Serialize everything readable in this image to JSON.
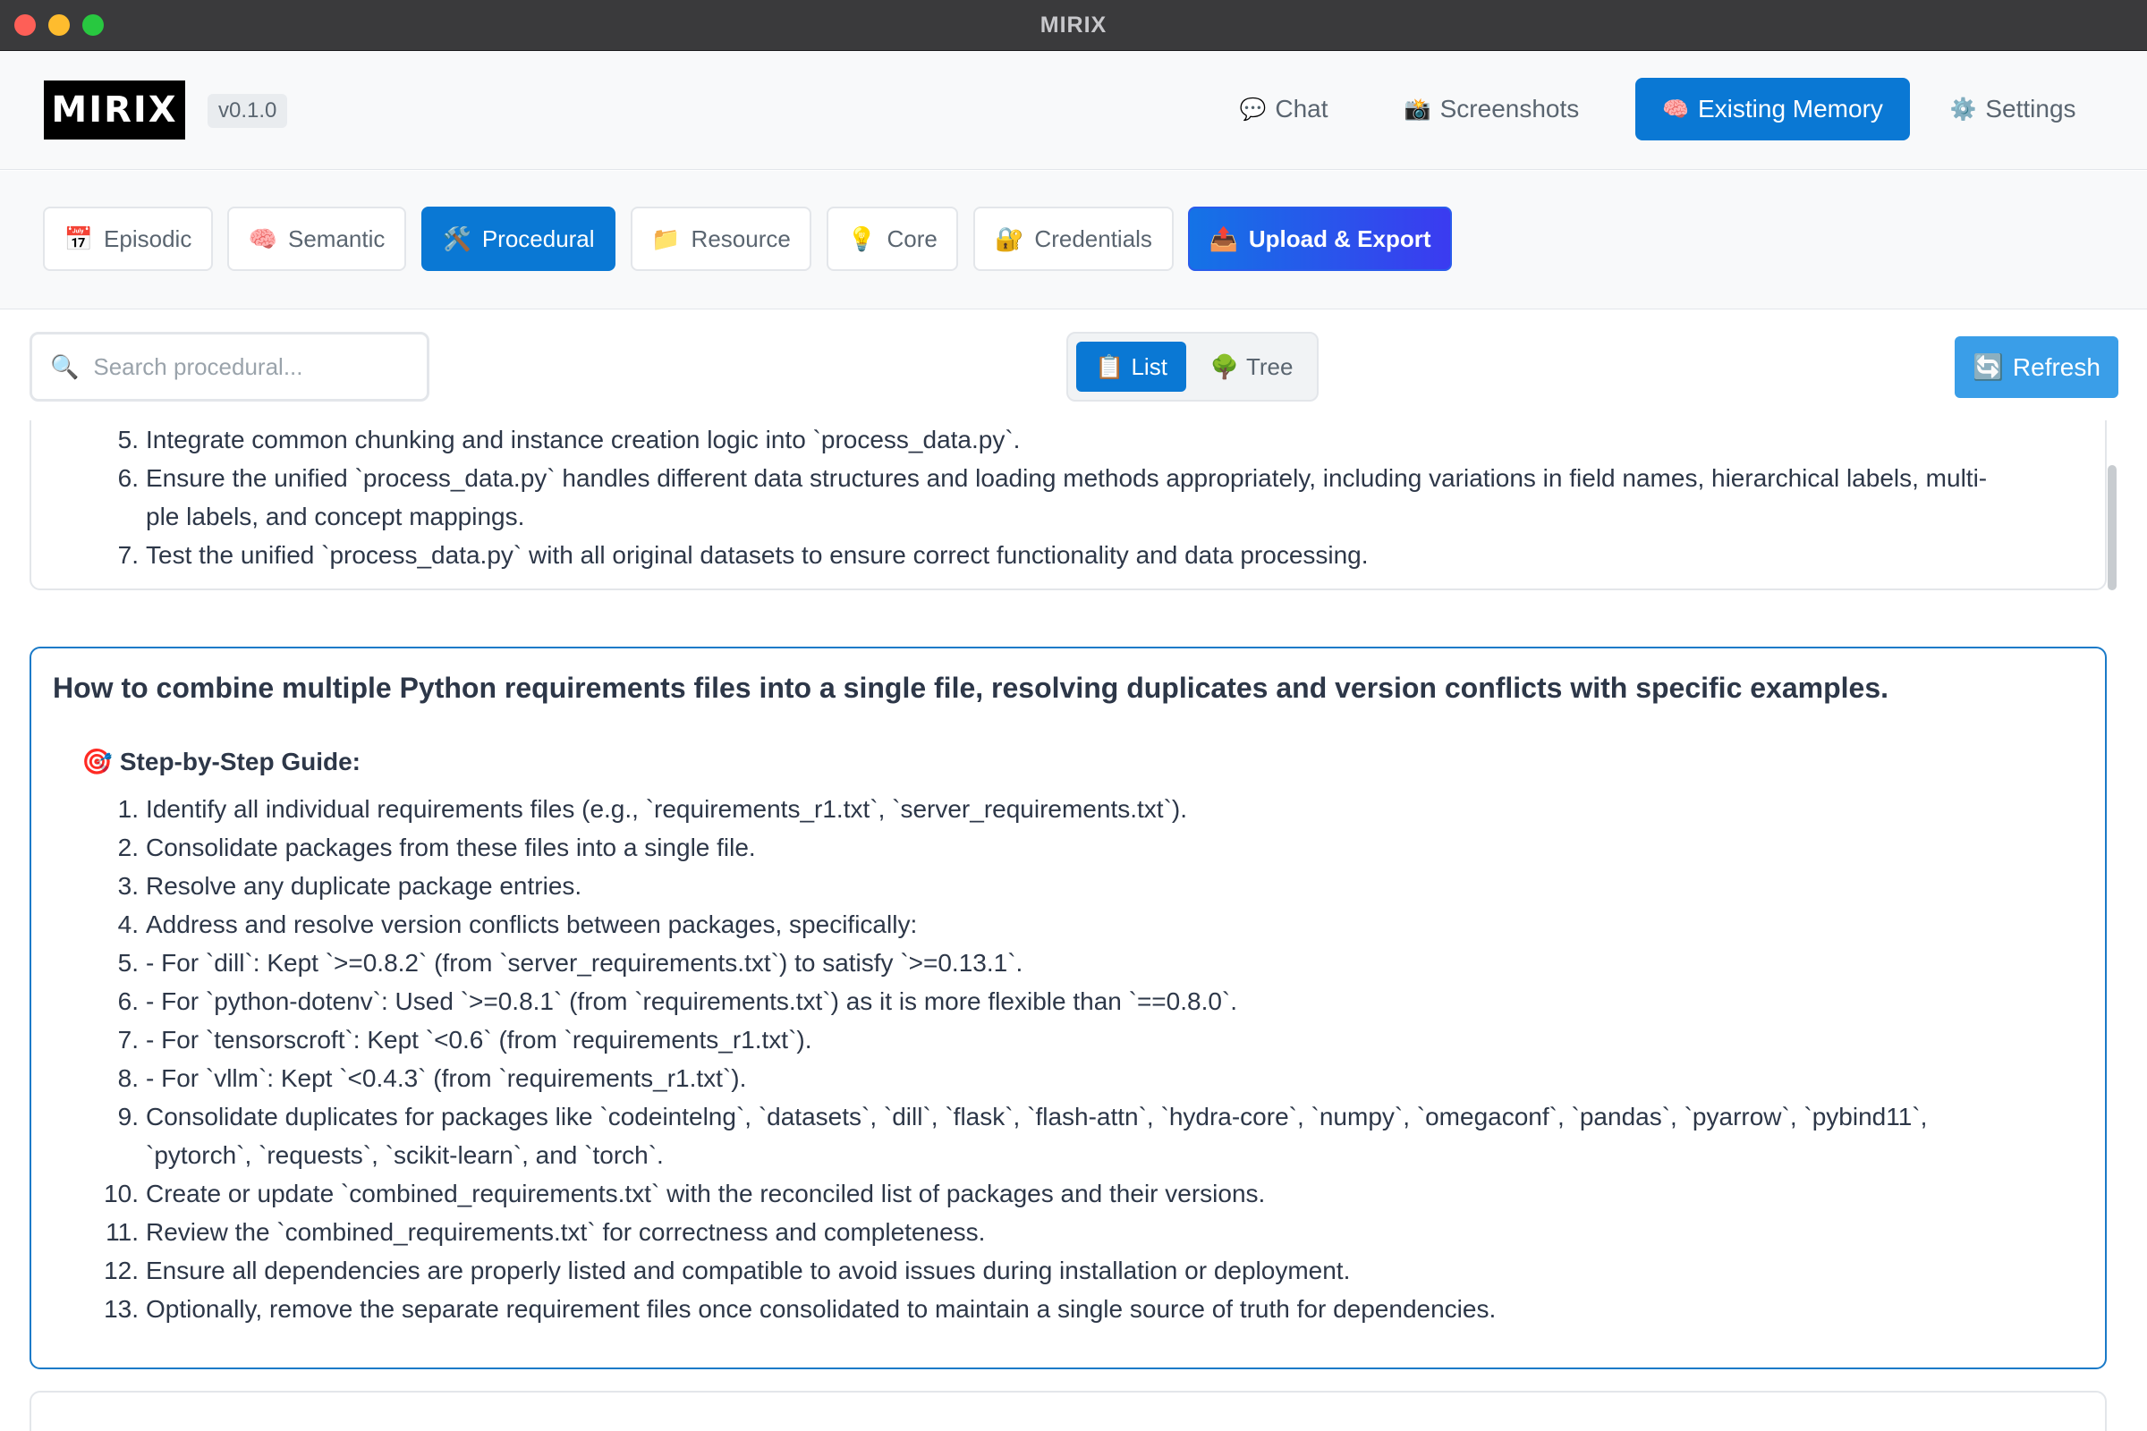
{
  "window": {
    "title": "MIRIX"
  },
  "header": {
    "logo_text": "MIRIX",
    "version": "v0.1.0",
    "nav": [
      {
        "icon": "💬",
        "label": "Chat"
      },
      {
        "icon": "📸",
        "label": "Screenshots"
      },
      {
        "icon": "🧠",
        "label": "Existing Memory"
      },
      {
        "icon": "⚙️",
        "label": "Settings"
      }
    ]
  },
  "memory_tabs": [
    {
      "icon": "📅",
      "label": "Episodic"
    },
    {
      "icon": "🧠",
      "label": "Semantic"
    },
    {
      "icon": "🛠️",
      "label": "Procedural"
    },
    {
      "icon": "📁",
      "label": "Resource"
    },
    {
      "icon": "💡",
      "label": "Core"
    },
    {
      "icon": "🔐",
      "label": "Credentials"
    },
    {
      "icon": "📤",
      "label": "Upload & Export"
    }
  ],
  "active_memory_tab": "Procedural",
  "toolbar": {
    "search_icon": "🔍",
    "search_placeholder": "Search procedural...",
    "view_list": {
      "icon": "📋",
      "label": "List"
    },
    "view_tree": {
      "icon": "🌳",
      "label": "Tree"
    },
    "refresh": {
      "icon": "🔄",
      "label": "Refresh"
    }
  },
  "previous_entry": {
    "steps": [
      {
        "num": "5.",
        "text": "Integrate common chunking and instance creation logic into `process_data.py`."
      },
      {
        "num": "6.",
        "text": "Ensure the unified `process_data.py` handles different data structures and loading methods appropriately, including variations in field names, hierarchical labels, multi-"
      },
      {
        "num": "",
        "text": "ple labels, and concept mappings."
      },
      {
        "num": "7.",
        "text": "Test the unified `process_data.py` with all original datasets to ensure correct functionality and data processing."
      }
    ]
  },
  "current_entry": {
    "title": "How to combine multiple Python requirements files into a single file, resolving duplicates and version conflicts with specific examples.",
    "guide_icon": "🎯",
    "guide_label": "Step-by-Step Guide:",
    "steps": [
      {
        "num": "1.",
        "text": "Identify all individual requirements files (e.g., `requirements_r1.txt`, `server_requirements.txt`)."
      },
      {
        "num": "2.",
        "text": "Consolidate packages from these files into a single file."
      },
      {
        "num": "3.",
        "text": "Resolve any duplicate package entries."
      },
      {
        "num": "4.",
        "text": "Address and resolve version conflicts between packages, specifically:"
      },
      {
        "num": "5.",
        "text": "- For `dill`: Kept `>=0.8.2` (from `server_requirements.txt`) to satisfy `>=0.13.1`."
      },
      {
        "num": "6.",
        "text": "- For `python-dotenv`: Used `>=0.8.1` (from `requirements.txt`) as it is more flexible than `==0.8.0`."
      },
      {
        "num": "7.",
        "text": "- For `tensorscroft`: Kept `<0.6` (from `requirements_r1.txt`)."
      },
      {
        "num": "8.",
        "text": "- For `vllm`: Kept `<0.4.3` (from `requirements_r1.txt`)."
      },
      {
        "num": "9.",
        "text": "Consolidate duplicates for packages like `codeintelng`, `datasets`, `dill`, `flask`, `flash-attn`, `hydra-core`, `numpy`, `omegaconf`, `pandas`, `pyarrow`, `pybind11`,"
      },
      {
        "num": "",
        "text": "`pytorch`, `requests`, `scikit-learn`, and `torch`."
      },
      {
        "num": "10.",
        "text": "Create or update `combined_requirements.txt` with the reconciled list of packages and their versions."
      },
      {
        "num": "11.",
        "text": "Review the `combined_requirements.txt` for correctness and completeness."
      },
      {
        "num": "12.",
        "text": "Ensure all dependencies are properly listed and compatible to avoid issues during installation or deployment."
      },
      {
        "num": "13.",
        "text": "Optionally, remove the separate requirement files once consolidated to maintain a single source of truth for dependencies."
      }
    ]
  },
  "colors": {
    "accent": "#0a78d4",
    "refresh": "#3a9ee8",
    "upload_gradient_start": "#1473e6",
    "upload_gradient_end": "#3b3bf0",
    "focus_border": "#1a7ac8"
  }
}
